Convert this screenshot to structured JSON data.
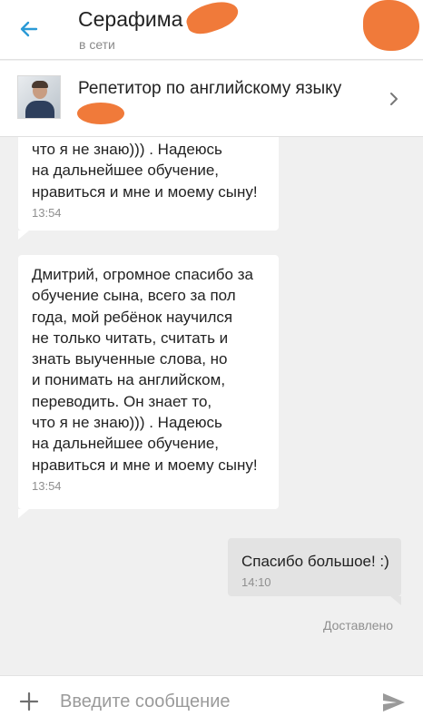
{
  "colors": {
    "accent": "#2b9ad6",
    "incoming_bubble": "#ffffff",
    "outgoing_bubble": "#e3e3e3",
    "background": "#f0f0f0",
    "redaction": "#f07a3a"
  },
  "header": {
    "back_icon": "arrow-left-icon",
    "contact_name": "Серафима",
    "status": "в сети"
  },
  "ad": {
    "title": "Репетитор по английскому языку",
    "chevron_icon": "chevron-right-icon"
  },
  "messages": [
    {
      "direction": "incoming",
      "lines": [
        "что я не знаю))) . Надеюсь",
        "на дальнейшее обучение,",
        "нравиться и мне и моему сыну!"
      ],
      "time": "13:54"
    },
    {
      "direction": "incoming",
      "lines": [
        "Дмитрий, огромное спасибо за",
        "обучение сына, всего за пол",
        "года, мой ребёнок научился",
        "не только читать, считать и",
        "знать выученные слова, но",
        "и понимать на английском,",
        "переводить. Он знает то,",
        "что я не знаю))) . Надеюсь",
        "на дальнейшее обучение,",
        "нравиться и мне и моему сыну!"
      ],
      "time": "13:54"
    },
    {
      "direction": "outgoing",
      "lines": [
        "Спасибо большое! :)"
      ],
      "time": "14:10"
    }
  ],
  "delivered_label": "Доставлено",
  "composer": {
    "attach_icon": "plus-icon",
    "placeholder": "Введите сообщение",
    "value": "",
    "send_icon": "send-icon"
  }
}
